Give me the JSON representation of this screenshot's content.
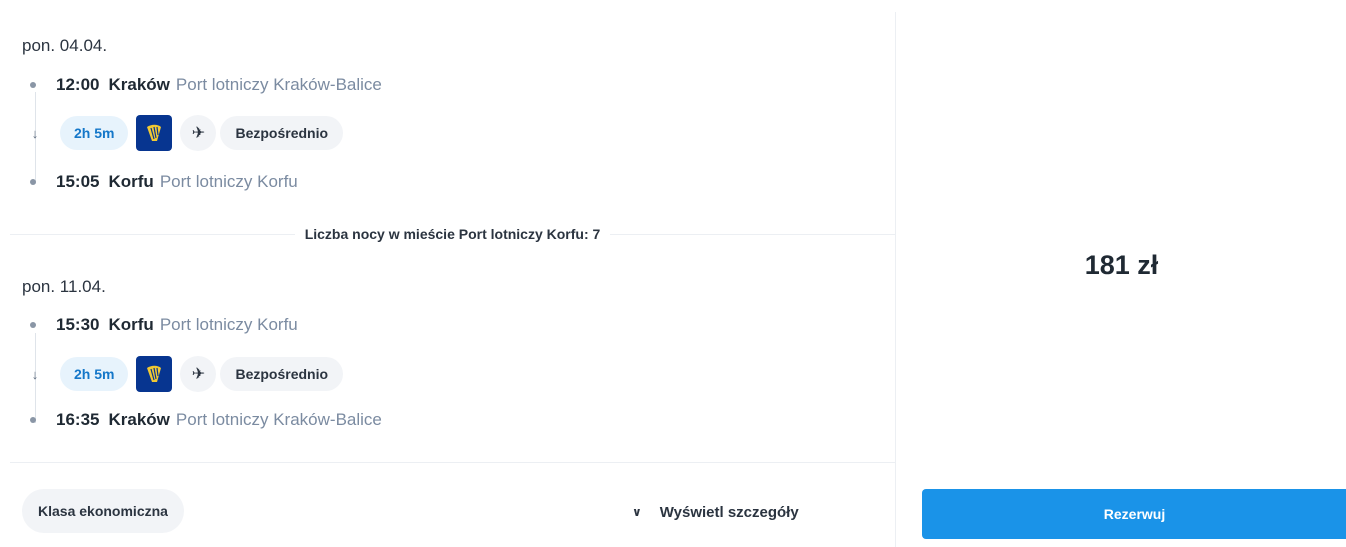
{
  "outbound": {
    "date": "pon. 04.04.",
    "depart": {
      "time": "12:00",
      "city": "Kraków",
      "airport": "Port lotniczy Kraków-Balice"
    },
    "segment": {
      "duration": "2h 5m",
      "airline_icon": "ryanair-harp-logo",
      "aircraft_icon": "airplane-icon",
      "type": "Bezpośrednio"
    },
    "arrive": {
      "time": "15:05",
      "city": "Korfu",
      "airport": "Port lotniczy Korfu"
    }
  },
  "stay": {
    "label": "Liczba nocy w mieście Port lotniczy Korfu: 7"
  },
  "return": {
    "date": "pon. 11.04.",
    "depart": {
      "time": "15:30",
      "city": "Korfu",
      "airport": "Port lotniczy Korfu"
    },
    "segment": {
      "duration": "2h 5m",
      "airline_icon": "ryanair-harp-logo",
      "aircraft_icon": "airplane-icon",
      "type": "Bezpośrednio"
    },
    "arrive": {
      "time": "16:35",
      "city": "Kraków",
      "airport": "Port lotniczy Kraków-Balice"
    }
  },
  "footer": {
    "cabin_class": "Klasa ekonomiczna",
    "details_label": "Wyświetl szczegóły",
    "details_icon": "chevron-down-icon"
  },
  "price": {
    "amount": "181 zł"
  },
  "book": {
    "label": "Rezerwuj"
  },
  "colors": {
    "accent": "#1a93e8",
    "duration_bg": "#e7f3fc",
    "duration_text": "#1477c9",
    "airline_logo_bg": "#073590",
    "muted_text": "#7b8ba1"
  }
}
